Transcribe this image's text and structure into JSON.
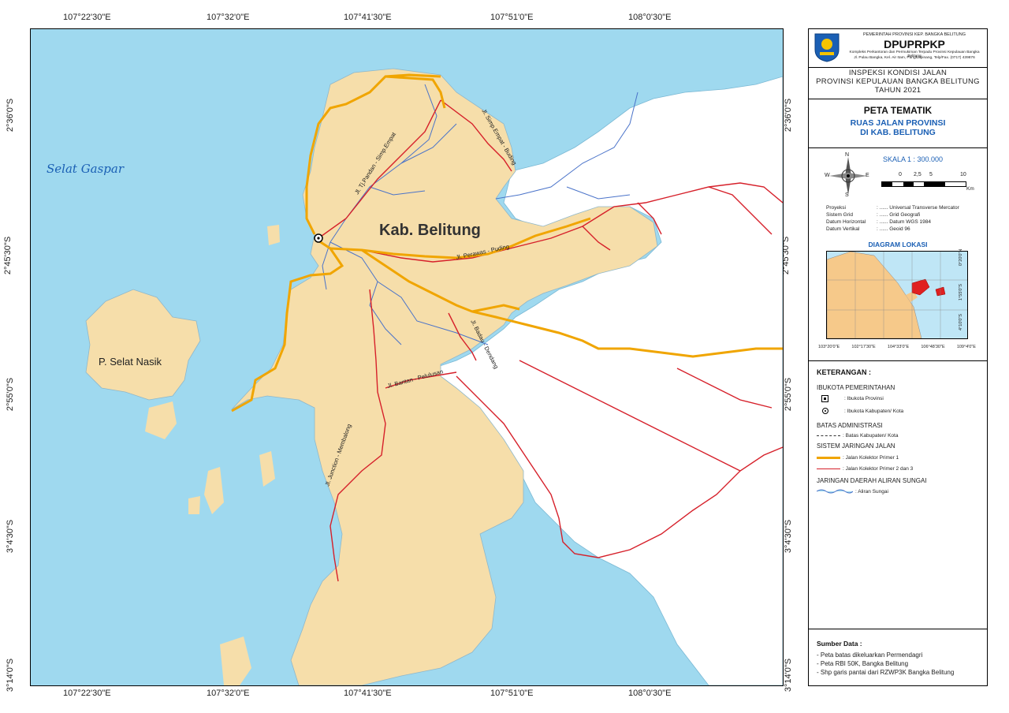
{
  "coords": {
    "top": [
      "107°22'30\"E",
      "107°32'0\"E",
      "107°41'30\"E",
      "107°51'0\"E",
      "108°0'30\"E"
    ],
    "bottom": [
      "107°22'30\"E",
      "107°32'0\"E",
      "107°41'30\"E",
      "107°51'0\"E",
      "108°0'30\"E"
    ],
    "left": [
      "2°36'0\"S",
      "2°45'30\"S",
      "2°55'0\"S",
      "3°4'30\"S",
      "3°14'0\"S"
    ],
    "right": [
      "2°36'0\"S",
      "2°45'30\"S",
      "2°55'0\"S",
      "3°4'30\"S",
      "3°14'0\"S"
    ]
  },
  "map": {
    "sea_label": "Selat Gaspar",
    "region_label": "Kab. Belitung",
    "island_label": "P. Selat Nasik",
    "roads": [
      "Jl. Tj.Pandan - Simp.Empat",
      "Jl. Simp.Empat - Buding",
      "Jl. Perawas - Puding",
      "Jl. Badau - Dendang",
      "Jl. Bantan - Pelulusan",
      "Jl. Junction - Membalong"
    ]
  },
  "panel": {
    "agency_line1": "PEMERINTAH PROVINSI KEP. BANGKA BELITUNG",
    "agency_name": "DPUPRPKP",
    "agency_line2": "Kompleks Perkantoran dan Permukiman Terpadu Provinsi Kepulauan Bangka Belitung",
    "agency_line3": "Jl. Pulau Bangka, Kel. Air Itam, Pangkalpinang, Telp/Fax. (0717) 439876",
    "project": [
      "INSPEKSI KONDISI JALAN",
      "PROVINSI KEPULAUAN BANGKA BELITUNG",
      "TAHUN 2021"
    ],
    "title": "PETA TEMATIK",
    "subtitle1": "RUAS JALAN PROVINSI",
    "subtitle2": "DI KAB. BELITUNG",
    "scale": "SKALA 1 : 300.000",
    "scale_ticks": [
      "0",
      "2,5",
      "5",
      "10"
    ],
    "scale_unit": "Km",
    "compass": {
      "n": "N",
      "s": "S",
      "e": "E",
      "w": "W"
    },
    "projection": [
      {
        "k": "Proyeksi",
        "v": ": ...... Universal Transverse Mercator"
      },
      {
        "k": "Sistem Grid",
        "v": ": ...... Grid Geografi"
      },
      {
        "k": "Datum Horizontal",
        "v": ": ...... Datum WGS 1984"
      },
      {
        "k": "Datum Vertikal",
        "v": ": ...... Geoid 96"
      }
    ],
    "diagram_title": "DIAGRAM LOKASI",
    "diagram_bottom": [
      "103°20'0\"E",
      "102°17'30\"E",
      "104°33'0\"E",
      "106°48'30\"E",
      "109°4'0\"E"
    ],
    "diagram_right": [
      "0°20'0\"N",
      "1°55'0\"S",
      "4°10'0\"S"
    ],
    "legend_title": "KETERANGAN :",
    "legend": {
      "ibukota_head": "IBUKOTA PEMERINTAHAN",
      "ibukota_prov": ": Ibukota Provinsi",
      "ibukota_kab": ": Ibukota Kabupaten/ Kota",
      "batas_head": "BATAS ADMINISTRASI",
      "batas_kab": ": Batas Kabupaten/ Kota",
      "jalan_head": "SISTEM JARINGAN JALAN",
      "jalan_k1": ": Jalan Kolektor Primer 1",
      "jalan_k23": ": Jalan Kolektor Primer 2 dan 3",
      "sungai_head": "JARINGAN DAERAH ALIRAN SUNGAI",
      "sungai": ": Aliran Sungai"
    },
    "source_title": "Sumber Data :",
    "sources": [
      "- Peta batas dikeluarkan Permendagri",
      "- Peta RBI 50K, Bangka Belitung",
      "- Shp garis pantai dari RZWP3K Bangka Belitung"
    ]
  },
  "colors": {
    "sea": "#9fd9ef",
    "land": "#f6deaa",
    "road1": "#f0a500",
    "road2": "#d6202a",
    "river": "#4a73c9",
    "white": "#ffffff"
  }
}
